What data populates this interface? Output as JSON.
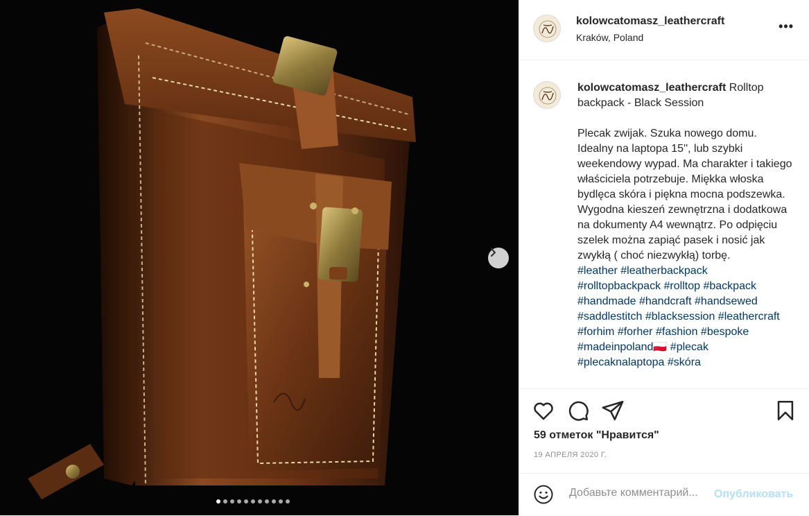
{
  "post": {
    "username": "kolowcatomasz_leathercraft",
    "location": "Kraków, Poland",
    "caption_title": "Rolltop backpack - Black Session",
    "caption_body": "Plecak zwijak. Szuka nowego domu. Idealny na laptopa 15'', lub szybki weekendowy wypad. Ma charakter i takiego właściciela potrzebuje. Miękka włoska bydlęca skóra i piękna mocna podszewka. Wygodna kieszeń zewnętrzna i dodatkowa na dokumenty A4 wewnątrz. Po odpięciu szelek można zapiąć pasek i nosić jak zwykłą ( choć niezwykłą) torbę.",
    "hashtags": [
      "#leather",
      "#leatherbackpack",
      "#rolltopbackpack",
      "#rolltop",
      "#backpack",
      "#handmade",
      "#handcraft",
      "#handsewed",
      "#saddlestitch",
      "#blacksession",
      "#leathercraft",
      "#forhim",
      "#forher",
      "#fashion",
      "#bespoke",
      "#madeinpoland🇵🇱",
      "#plecak",
      "#plecaknalaptopa",
      "#skóra"
    ],
    "likes": "59 отметок \"Нравится\"",
    "date": "19 АПРЕЛЯ 2020 Г."
  },
  "carousel": {
    "count": 11,
    "active_index": 0
  },
  "comment_box": {
    "placeholder": "Добавьте комментарий...",
    "publish_label": "Опубликовать"
  },
  "icons": {
    "more": "more-options-icon",
    "next": "chevron-right-icon",
    "like": "heart-icon",
    "comment": "comment-bubble-icon",
    "share": "paper-plane-icon",
    "save": "bookmark-icon",
    "emoji": "emoji-smile-icon"
  },
  "colors": {
    "link": "#00376b",
    "publish_disabled": "#b2dffc",
    "meta_gray": "#8e8e8e",
    "text": "#262626"
  }
}
